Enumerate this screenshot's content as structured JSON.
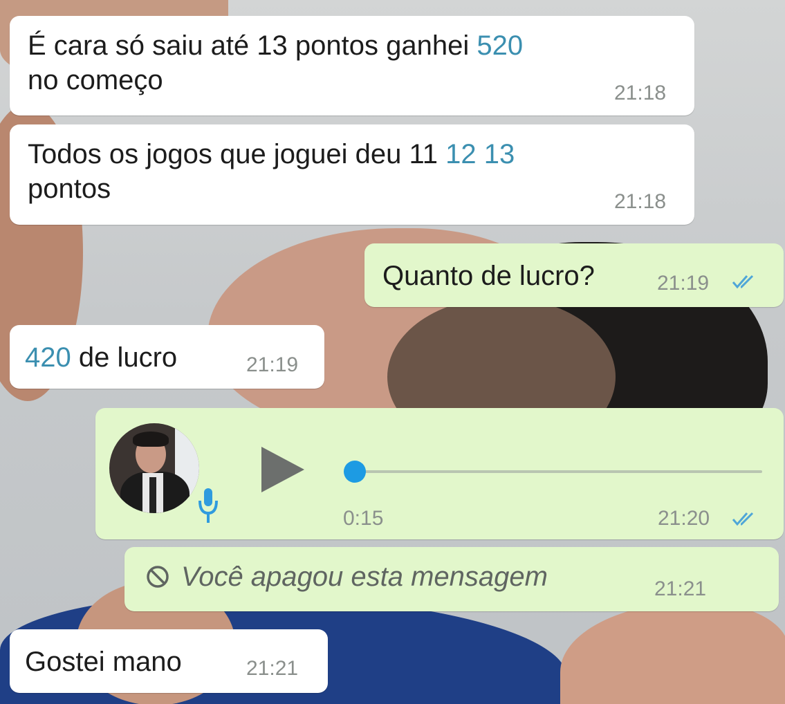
{
  "colors": {
    "incoming_bubble": "#ffffff",
    "outgoing_bubble": "#e2f7cb",
    "number_link": "#3b8fb0",
    "timestamp": "#8a8f8c",
    "read_ticks": "#4fa6d8",
    "voice_progress": "#1d9be3"
  },
  "messages": [
    {
      "direction": "incoming",
      "line1_text": "É cara só saiu até 13 pontos ganhei ",
      "line1_num": "520",
      "line2_text": "no começo",
      "time": "21:18"
    },
    {
      "direction": "incoming",
      "line1_text": "Todos os jogos que joguei deu 11 ",
      "line1_num": "12 13",
      "line2_text": "pontos",
      "time": "21:18"
    },
    {
      "direction": "outgoing",
      "text": "Quanto de lucro?",
      "time": "21:19",
      "status_icon": "double-check-icon"
    },
    {
      "direction": "incoming",
      "num": "420",
      "text": " de lucro",
      "time": "21:19"
    }
  ],
  "voice_message": {
    "direction": "outgoing",
    "duration": "0:15",
    "time": "21:20",
    "progress": 0.0,
    "icons": [
      "play-icon",
      "microphone-icon",
      "double-check-icon"
    ]
  },
  "deleted_message": {
    "direction": "outgoing",
    "text": "Você apagou esta mensagem",
    "time": "21:21",
    "icon": "ban-icon"
  },
  "last_message": {
    "direction": "incoming",
    "text": "Gostei mano",
    "time": "21:21"
  }
}
